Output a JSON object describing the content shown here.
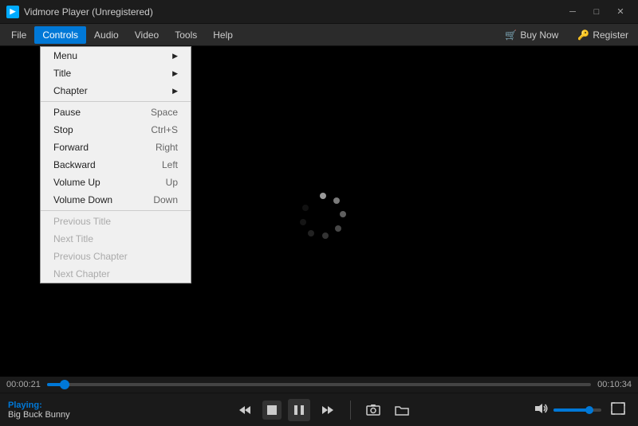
{
  "titlebar": {
    "app_name": "Vidmore Player (Unregistered)",
    "minimize": "─",
    "maximize": "□",
    "close": "✕"
  },
  "menubar": {
    "items": [
      {
        "id": "file",
        "label": "File"
      },
      {
        "id": "controls",
        "label": "Controls",
        "active": true
      },
      {
        "id": "audio",
        "label": "Audio"
      },
      {
        "id": "video",
        "label": "Video"
      },
      {
        "id": "tools",
        "label": "Tools"
      },
      {
        "id": "help",
        "label": "Help"
      }
    ],
    "buy_now": "Buy Now",
    "register": "Register"
  },
  "controls_menu": {
    "items": [
      {
        "id": "menu",
        "label": "Menu",
        "shortcut": "",
        "submenu": true,
        "disabled": false
      },
      {
        "id": "title",
        "label": "Title",
        "shortcut": "",
        "submenu": true,
        "disabled": false
      },
      {
        "id": "chapter",
        "label": "Chapter",
        "shortcut": "",
        "submenu": true,
        "disabled": false
      },
      {
        "separator": true
      },
      {
        "id": "pause",
        "label": "Pause",
        "shortcut": "Space",
        "disabled": false
      },
      {
        "id": "stop",
        "label": "Stop",
        "shortcut": "Ctrl+S",
        "disabled": false
      },
      {
        "id": "forward",
        "label": "Forward",
        "shortcut": "Right",
        "disabled": false
      },
      {
        "id": "backward",
        "label": "Backward",
        "shortcut": "Left",
        "disabled": false
      },
      {
        "id": "volume_up",
        "label": "Volume Up",
        "shortcut": "Up",
        "disabled": false
      },
      {
        "id": "volume_down",
        "label": "Volume Down",
        "shortcut": "Down",
        "disabled": false
      },
      {
        "separator": true
      },
      {
        "id": "prev_title",
        "label": "Previous Title",
        "shortcut": "",
        "disabled": true
      },
      {
        "id": "next_title",
        "label": "Next Title",
        "shortcut": "",
        "disabled": true
      },
      {
        "id": "prev_chapter",
        "label": "Previous Chapter",
        "shortcut": "",
        "disabled": true
      },
      {
        "id": "next_chapter",
        "label": "Next Chapter",
        "shortcut": "",
        "disabled": true
      }
    ]
  },
  "progress": {
    "current": "00:00:21",
    "total": "00:10:34",
    "percent": 3.3
  },
  "volume": {
    "percent": 75
  },
  "now_playing": {
    "label": "Playing:",
    "track": "Big Buck Bunny"
  }
}
